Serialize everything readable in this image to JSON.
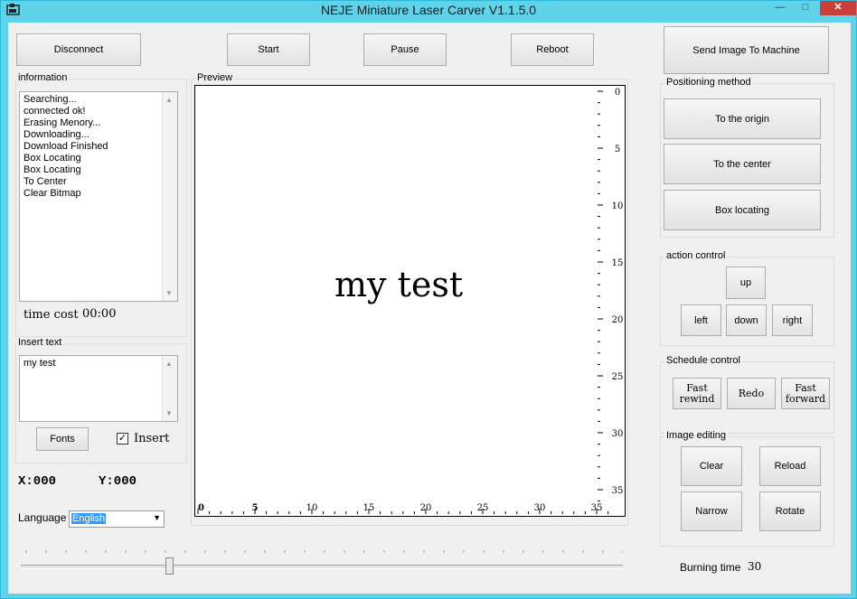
{
  "window": {
    "title": "NEJE Miniature Laser Carver V1.1.5.0",
    "minimize": "—",
    "maximize": "□",
    "close": "✕"
  },
  "toolbar": {
    "disconnect": "Disconnect",
    "start": "Start",
    "pause": "Pause",
    "reboot": "Reboot",
    "send_image": "Send Image To Machine"
  },
  "information": {
    "label": "information",
    "log": [
      "Searching...",
      "connected ok!",
      "Erasing Menory...",
      "Downloading...",
      "Download Finished",
      "Box Locating",
      "Box Locating",
      "To Center",
      "Clear Bitmap"
    ],
    "time_cost_label": "time cost",
    "time_cost_value": "00:00"
  },
  "insert_text": {
    "label": "Insert text",
    "value": "my test",
    "fonts_button": "Fonts",
    "insert_checkbox_label": "Insert",
    "insert_checked": true
  },
  "coords": {
    "x_label": "X:000",
    "y_label": "Y:000"
  },
  "language": {
    "label": "Language",
    "selected": "English"
  },
  "preview": {
    "label": "Preview",
    "canvas_text": "my test",
    "right_ticks": [
      "0",
      "5",
      "10",
      "15",
      "20",
      "25",
      "30",
      "35"
    ],
    "bottom_ticks": [
      "0",
      "5",
      "10",
      "15",
      "20",
      "25",
      "30",
      "35"
    ]
  },
  "positioning": {
    "label": "Positioning method",
    "to_origin": "To the origin",
    "to_center": "To the center",
    "box_locating": "Box locating"
  },
  "action_control": {
    "label": "action control",
    "up": "up",
    "left": "left",
    "down": "down",
    "right": "right"
  },
  "schedule_control": {
    "label": "Schedule control",
    "fast_rewind_1": "Fast",
    "fast_rewind_2": "rewind",
    "redo": "Redo",
    "fast_forward_1": "Fast",
    "fast_forward_2": "forward"
  },
  "image_editing": {
    "label": "Image editing",
    "clear": "Clear",
    "reload": "Reload",
    "narrow": "Narrow",
    "rotate": "Rotate"
  },
  "burning": {
    "label": "Burning time",
    "value": "30",
    "slider_fraction": 0.24
  }
}
